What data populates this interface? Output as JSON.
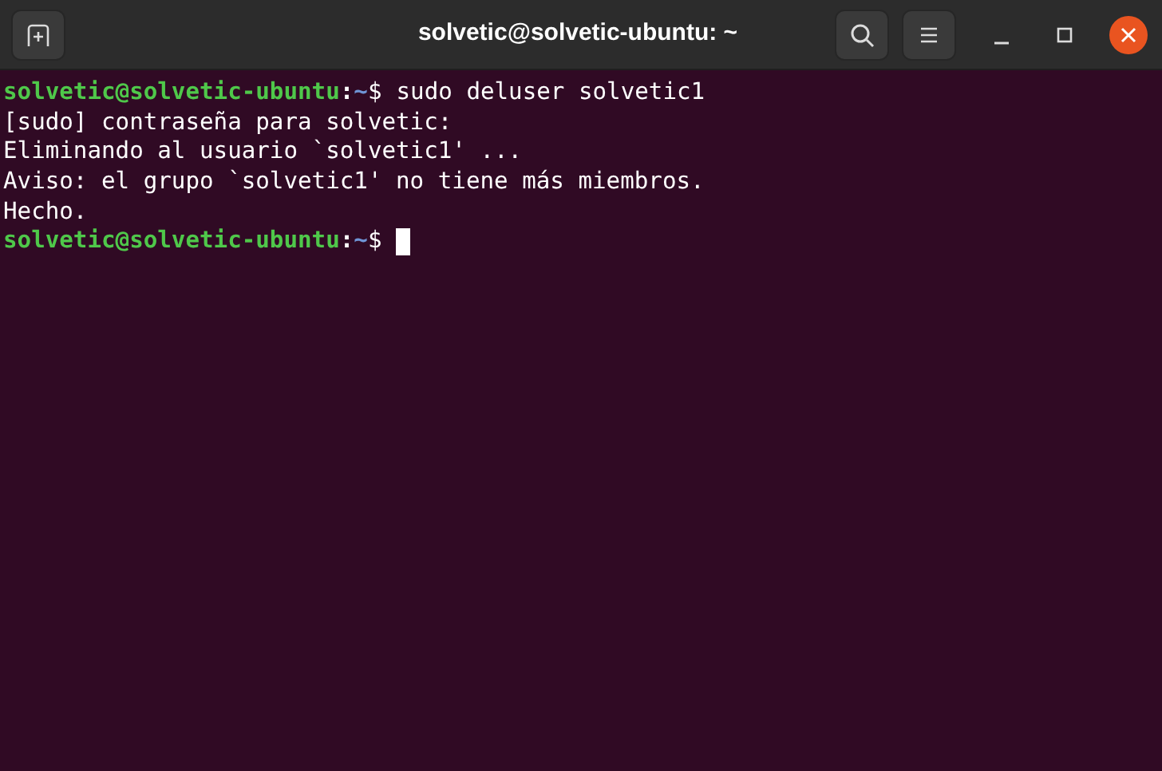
{
  "window": {
    "title": "solvetic@solvetic-ubuntu: ~"
  },
  "lines": [
    {
      "kind": "prompt",
      "user_host": "solvetic@solvetic-ubuntu",
      "separator": ":",
      "path": "~",
      "symbol": "$",
      "command": "sudo deluser solvetic1",
      "cursor": false
    },
    {
      "kind": "output",
      "text": "[sudo] contraseña para solvetic:"
    },
    {
      "kind": "output",
      "text": "Eliminando al usuario `solvetic1' ..."
    },
    {
      "kind": "output",
      "text": "Aviso: el grupo `solvetic1' no tiene más miembros."
    },
    {
      "kind": "output",
      "text": "Hecho."
    },
    {
      "kind": "prompt",
      "user_host": "solvetic@solvetic-ubuntu",
      "separator": ":",
      "path": "~",
      "symbol": "$",
      "cursor": true
    }
  ]
}
